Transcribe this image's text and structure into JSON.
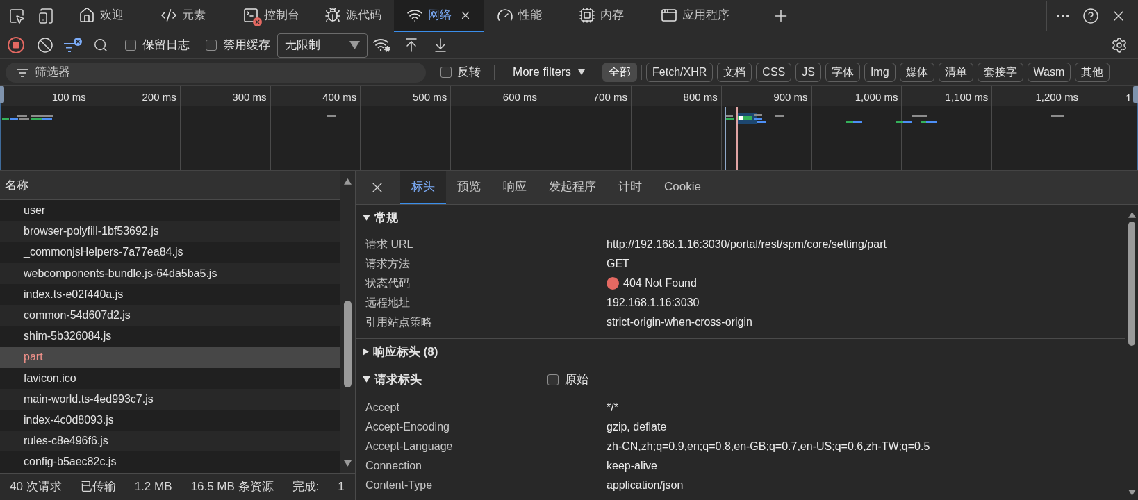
{
  "devtools_tabs": [
    {
      "label": "欢迎",
      "kind": "welcome",
      "selected": false,
      "badge": false
    },
    {
      "label": "元素",
      "kind": "elements",
      "selected": false,
      "badge": false
    },
    {
      "label": "控制台",
      "kind": "console",
      "selected": false,
      "badge": true
    },
    {
      "label": "源代码",
      "kind": "sources",
      "selected": false,
      "badge": false
    },
    {
      "label": "网络",
      "kind": "network",
      "selected": true,
      "badge": false
    },
    {
      "label": "性能",
      "kind": "performance",
      "selected": false,
      "badge": false
    },
    {
      "label": "内存",
      "kind": "memory",
      "selected": false,
      "badge": false
    },
    {
      "label": "应用程序",
      "kind": "application",
      "selected": false,
      "badge": false
    }
  ],
  "toolbar": {
    "recording": true,
    "options": [
      {
        "label": "保留日志",
        "checked": false
      },
      {
        "label": "禁用缓存",
        "checked": false
      }
    ],
    "throttling": "无限制"
  },
  "filter_bar": {
    "placeholder": "筛选器",
    "invert": {
      "label": "反转",
      "checked": false
    },
    "more_filters": "More filters",
    "types": [
      {
        "label": "全部",
        "selected": true
      },
      {
        "label": "Fetch/XHR",
        "selected": false
      },
      {
        "label": "文档",
        "selected": false
      },
      {
        "label": "CSS",
        "selected": false
      },
      {
        "label": "JS",
        "selected": false
      },
      {
        "label": "字体",
        "selected": false
      },
      {
        "label": "Img",
        "selected": false
      },
      {
        "label": "媒体",
        "selected": false
      },
      {
        "label": "清单",
        "selected": false
      },
      {
        "label": "套接字",
        "selected": false
      },
      {
        "label": "Wasm",
        "selected": false
      },
      {
        "label": "其他",
        "selected": false
      }
    ]
  },
  "timeline": {
    "ticks": [
      "100 ms",
      "200 ms",
      "300 ms",
      "400 ms",
      "500 ms",
      "600 ms",
      "700 ms",
      "800 ms",
      "900 ms",
      "1,000 ms",
      "1,100 ms",
      "1,200 ms",
      "1"
    ]
  },
  "requests": {
    "column": "名称",
    "rows": [
      {
        "name": "user",
        "selected": false,
        "failed": false
      },
      {
        "name": "browser-polyfill-1bf53692.js",
        "selected": false,
        "failed": false
      },
      {
        "name": "_commonjsHelpers-7a77ea84.js",
        "selected": false,
        "failed": false
      },
      {
        "name": "webcomponents-bundle.js-64da5ba5.js",
        "selected": false,
        "failed": false
      },
      {
        "name": "index.ts-e02f440a.js",
        "selected": false,
        "failed": false
      },
      {
        "name": "common-54d607d2.js",
        "selected": false,
        "failed": false
      },
      {
        "name": "shim-5b326084.js",
        "selected": false,
        "failed": false
      },
      {
        "name": "part",
        "selected": true,
        "failed": true
      },
      {
        "name": "favicon.ico",
        "selected": false,
        "failed": false
      },
      {
        "name": "main-world.ts-4ed993c7.js",
        "selected": false,
        "failed": false
      },
      {
        "name": "index-4c0d8093.js",
        "selected": false,
        "failed": false
      },
      {
        "name": "rules-c8e496f6.js",
        "selected": false,
        "failed": false
      },
      {
        "name": "config-b5aec82c.js",
        "selected": false,
        "failed": false
      }
    ]
  },
  "status_bar": [
    "40 次请求",
    "已传输",
    "1.2 MB",
    "16.5 MB 条资源",
    "完成:",
    "1"
  ],
  "details": {
    "tabs": [
      {
        "label": "标头",
        "selected": true
      },
      {
        "label": "预览",
        "selected": false
      },
      {
        "label": "响应",
        "selected": false
      },
      {
        "label": "发起程序",
        "selected": false
      },
      {
        "label": "计时",
        "selected": false
      },
      {
        "label": "Cookie",
        "selected": false
      }
    ],
    "sections": [
      {
        "title": "常规",
        "expanded": true,
        "rows": [
          {
            "name": "请求 URL",
            "value": "http://192.168.1.16:3030/portal/rest/spm/core/setting/part"
          },
          {
            "name": "请求方法",
            "value": "GET"
          },
          {
            "name": "状态代码",
            "value": "404 Not Found",
            "color": "#e46962"
          },
          {
            "name": "远程地址",
            "value": "192.168.1.16:3030"
          },
          {
            "name": "引用站点策略",
            "value": "strict-origin-when-cross-origin"
          }
        ]
      },
      {
        "title": "响应标头 (8)",
        "expanded": false
      },
      {
        "title": "请求标头",
        "expanded": true,
        "raw_toggle": {
          "label": "原始",
          "checked": false
        },
        "rows": [
          {
            "name": "Accept",
            "value": "*/*"
          },
          {
            "name": "Accept-Encoding",
            "value": "gzip, deflate"
          },
          {
            "name": "Accept-Language",
            "value": "zh-CN,zh;q=0.9,en;q=0.8,en-GB;q=0.7,en-US;q=0.6,zh-TW;q=0.5"
          },
          {
            "name": "Connection",
            "value": "keep-alive"
          },
          {
            "name": "Content-Type",
            "value": "application/json"
          }
        ]
      }
    ]
  }
}
